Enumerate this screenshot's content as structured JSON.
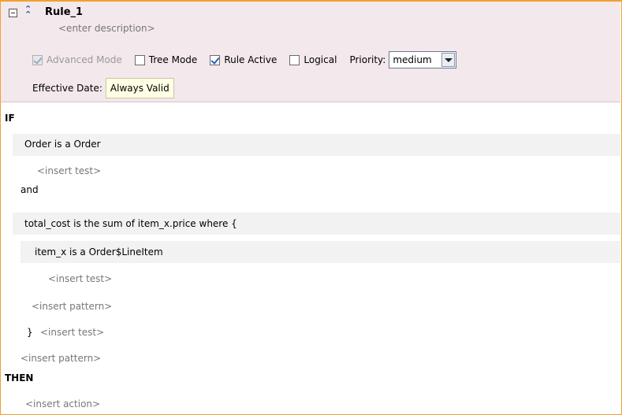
{
  "rule": {
    "name": "Rule_1",
    "description_placeholder": "<enter description>"
  },
  "options": {
    "advanced_mode": {
      "label": "Advanced Mode",
      "checked": true,
      "disabled": true
    },
    "tree_mode": {
      "label": "Tree Mode",
      "checked": false
    },
    "rule_active": {
      "label": "Rule Active",
      "checked": true
    },
    "logical": {
      "label": "Logical",
      "checked": false
    },
    "priority_label": "Priority:",
    "priority_value": "medium"
  },
  "effective_date": {
    "label": "Effective Date:",
    "value": "Always Valid"
  },
  "body": {
    "if_keyword": "IF",
    "pattern1": "Order is a Order",
    "insert_test_1": "<insert test>",
    "and": "and",
    "pattern2": "total_cost is the sum of item_x.price where {",
    "pattern2_inner": "item_x is a Order$LineItem",
    "insert_test_2": "<insert test>",
    "insert_pattern_1": "<insert pattern>",
    "close_brace": "}",
    "insert_test_3": "<insert test>",
    "insert_pattern_2": "<insert pattern>",
    "then_keyword": "THEN",
    "insert_action": "<insert action>"
  }
}
